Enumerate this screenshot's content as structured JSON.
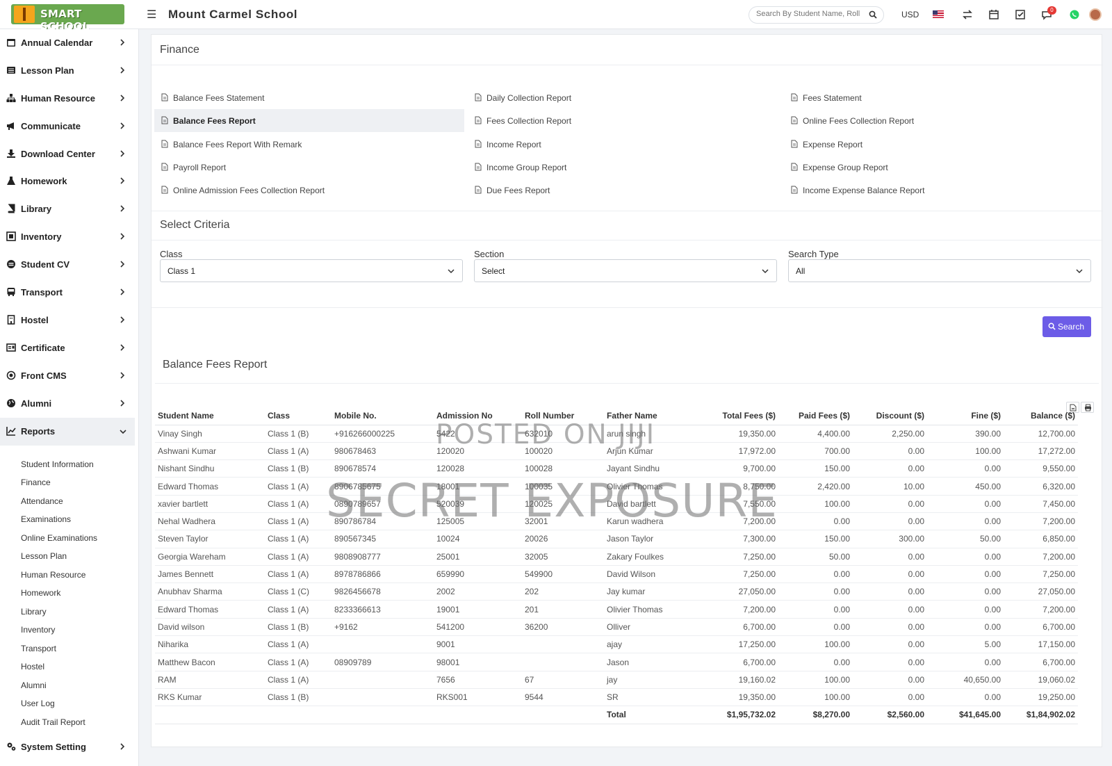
{
  "header": {
    "logo_text": "SMART SCHOOL",
    "school_name": "Mount Carmel School",
    "search_placeholder": "Search By Student Name, Roll Number, Enroll Number, National Id, Local Id Etc.",
    "currency": "USD",
    "notification_count": "0"
  },
  "sidebar": {
    "items": [
      {
        "label": "Annual Calendar",
        "icon": "calendar-icon"
      },
      {
        "label": "Lesson Plan",
        "icon": "list-icon"
      },
      {
        "label": "Human Resource",
        "icon": "sitemap-icon"
      },
      {
        "label": "Communicate",
        "icon": "bullhorn-icon"
      },
      {
        "label": "Download Center",
        "icon": "download-icon"
      },
      {
        "label": "Homework",
        "icon": "flask-icon"
      },
      {
        "label": "Library",
        "icon": "book-icon"
      },
      {
        "label": "Inventory",
        "icon": "inventory-icon"
      },
      {
        "label": "Student CV",
        "icon": "cv-icon"
      },
      {
        "label": "Transport",
        "icon": "bus-icon"
      },
      {
        "label": "Hostel",
        "icon": "building-icon"
      },
      {
        "label": "Certificate",
        "icon": "certificate-icon"
      },
      {
        "label": "Front CMS",
        "icon": "cms-icon"
      },
      {
        "label": "Alumni",
        "icon": "globe-icon"
      },
      {
        "label": "Reports",
        "icon": "chart-line-icon"
      }
    ],
    "reports_submenu": [
      "Student Information",
      "Finance",
      "Attendance",
      "Examinations",
      "Online Examinations",
      "Lesson Plan",
      "Human Resource",
      "Homework",
      "Library",
      "Inventory",
      "Transport",
      "Hostel",
      "Alumni",
      "User Log",
      "Audit Trail Report"
    ],
    "system_setting": "System Setting"
  },
  "finance": {
    "title": "Finance",
    "links": [
      "Balance Fees Statement",
      "Daily Collection Report",
      "Fees Statement",
      "Balance Fees Report",
      "Fees Collection Report",
      "Online Fees Collection Report",
      "Balance Fees Report With Remark",
      "Income Report",
      "Expense Report",
      "Payroll Report",
      "Income Group Report",
      "Expense Group Report",
      "Online Admission Fees Collection Report",
      "Due Fees Report",
      "Income Expense Balance Report"
    ]
  },
  "criteria": {
    "title": "Select Criteria",
    "class_label": "Class",
    "class_value": "Class 1",
    "section_label": "Section",
    "section_value": "Select",
    "search_type_label": "Search Type",
    "search_type_value": "All",
    "search_button": "Search"
  },
  "report": {
    "title": "Balance Fees Report",
    "columns": [
      "Student Name",
      "Class",
      "Mobile No.",
      "Admission No",
      "Roll Number",
      "Father Name",
      "Total Fees ($)",
      "Paid Fees ($)",
      "Discount ($)",
      "Fine ($)",
      "Balance ($)"
    ],
    "rows": [
      [
        "Vinay Singh",
        "Class 1 (B)",
        "+916266000225",
        "5422",
        "632010",
        "arun singh",
        "19,350.00",
        "4,400.00",
        "2,250.00",
        "390.00",
        "12,700.00"
      ],
      [
        "Ashwani Kumar",
        "Class 1 (A)",
        "980678463",
        "120020",
        "100020",
        "Arjun Kumar",
        "17,972.00",
        "700.00",
        "0.00",
        "100.00",
        "17,272.00"
      ],
      [
        "Nishant Sindhu",
        "Class 1 (B)",
        "890678574",
        "120028",
        "100028",
        "Jayant Sindhu",
        "9,700.00",
        "150.00",
        "0.00",
        "0.00",
        "9,550.00"
      ],
      [
        "Edward Thomas",
        "Class 1 (A)",
        "8906785675",
        "18001",
        "100035",
        "Olivier Thomas",
        "8,750.00",
        "2,420.00",
        "10.00",
        "450.00",
        "6,320.00"
      ],
      [
        "xavier bartlett",
        "Class 1 (A)",
        "0890789657",
        "520039",
        "120025",
        "David bartlett",
        "7,550.00",
        "100.00",
        "0.00",
        "0.00",
        "7,450.00"
      ],
      [
        "Nehal Wadhera",
        "Class 1 (A)",
        "890786784",
        "125005",
        "32001",
        "Karun wadhera",
        "7,200.00",
        "0.00",
        "0.00",
        "0.00",
        "7,200.00"
      ],
      [
        "Steven Taylor",
        "Class 1 (A)",
        "890567345",
        "10024",
        "20026",
        "Jason Taylor",
        "7,300.00",
        "150.00",
        "300.00",
        "50.00",
        "6,850.00"
      ],
      [
        "Georgia Wareham",
        "Class 1 (A)",
        "9808908777",
        "25001",
        "32005",
        "Zakary Foulkes",
        "7,250.00",
        "50.00",
        "0.00",
        "0.00",
        "7,200.00"
      ],
      [
        "James Bennett",
        "Class 1 (A)",
        "8978786866",
        "659990",
        "549900",
        "David Wilson",
        "7,250.00",
        "0.00",
        "0.00",
        "0.00",
        "7,250.00"
      ],
      [
        "Anubhav Sharma",
        "Class 1 (C)",
        "9826456678",
        "2002",
        "202",
        "Jay kumar",
        "27,050.00",
        "0.00",
        "0.00",
        "0.00",
        "27,050.00"
      ],
      [
        "Edward Thomas",
        "Class 1 (A)",
        "8233366613",
        "19001",
        "201",
        "Olivier Thomas",
        "7,200.00",
        "0.00",
        "0.00",
        "0.00",
        "7,200.00"
      ],
      [
        "David wilson",
        "Class 1 (B)",
        "+9162",
        "541200",
        "36200",
        "Olliver",
        "6,700.00",
        "0.00",
        "0.00",
        "0.00",
        "6,700.00"
      ],
      [
        "Niharika",
        "Class 1 (A)",
        "",
        "9001",
        "",
        "ajay",
        "17,250.00",
        "100.00",
        "0.00",
        "5.00",
        "17,150.00"
      ],
      [
        "Matthew Bacon",
        "Class 1 (A)",
        "08909789",
        "98001",
        "",
        "Jason",
        "6,700.00",
        "0.00",
        "0.00",
        "0.00",
        "6,700.00"
      ],
      [
        "RAM",
        "Class 1 (A)",
        "",
        "7656",
        "67",
        "jay",
        "19,160.02",
        "100.00",
        "0.00",
        "40,650.00",
        "19,060.02"
      ],
      [
        "RKS Kumar",
        "Class 1 (B)",
        "",
        "RKS001",
        "9544",
        "SR",
        "19,350.00",
        "100.00",
        "0.00",
        "0.00",
        "19,250.00"
      ]
    ],
    "total_label": "Total",
    "totals": [
      "$1,95,732.02",
      "$8,270.00",
      "$2,560.00",
      "$41,645.00",
      "$1,84,902.02"
    ]
  },
  "watermark": {
    "line1": "POSTED ON JIJI",
    "line2": "SECRET EXPOSURE"
  },
  "colors": {
    "accent": "#6c5ce7",
    "logo_green": "#6aa84f",
    "logo_orange": "#f4a51c",
    "badge_red": "#e53935"
  }
}
